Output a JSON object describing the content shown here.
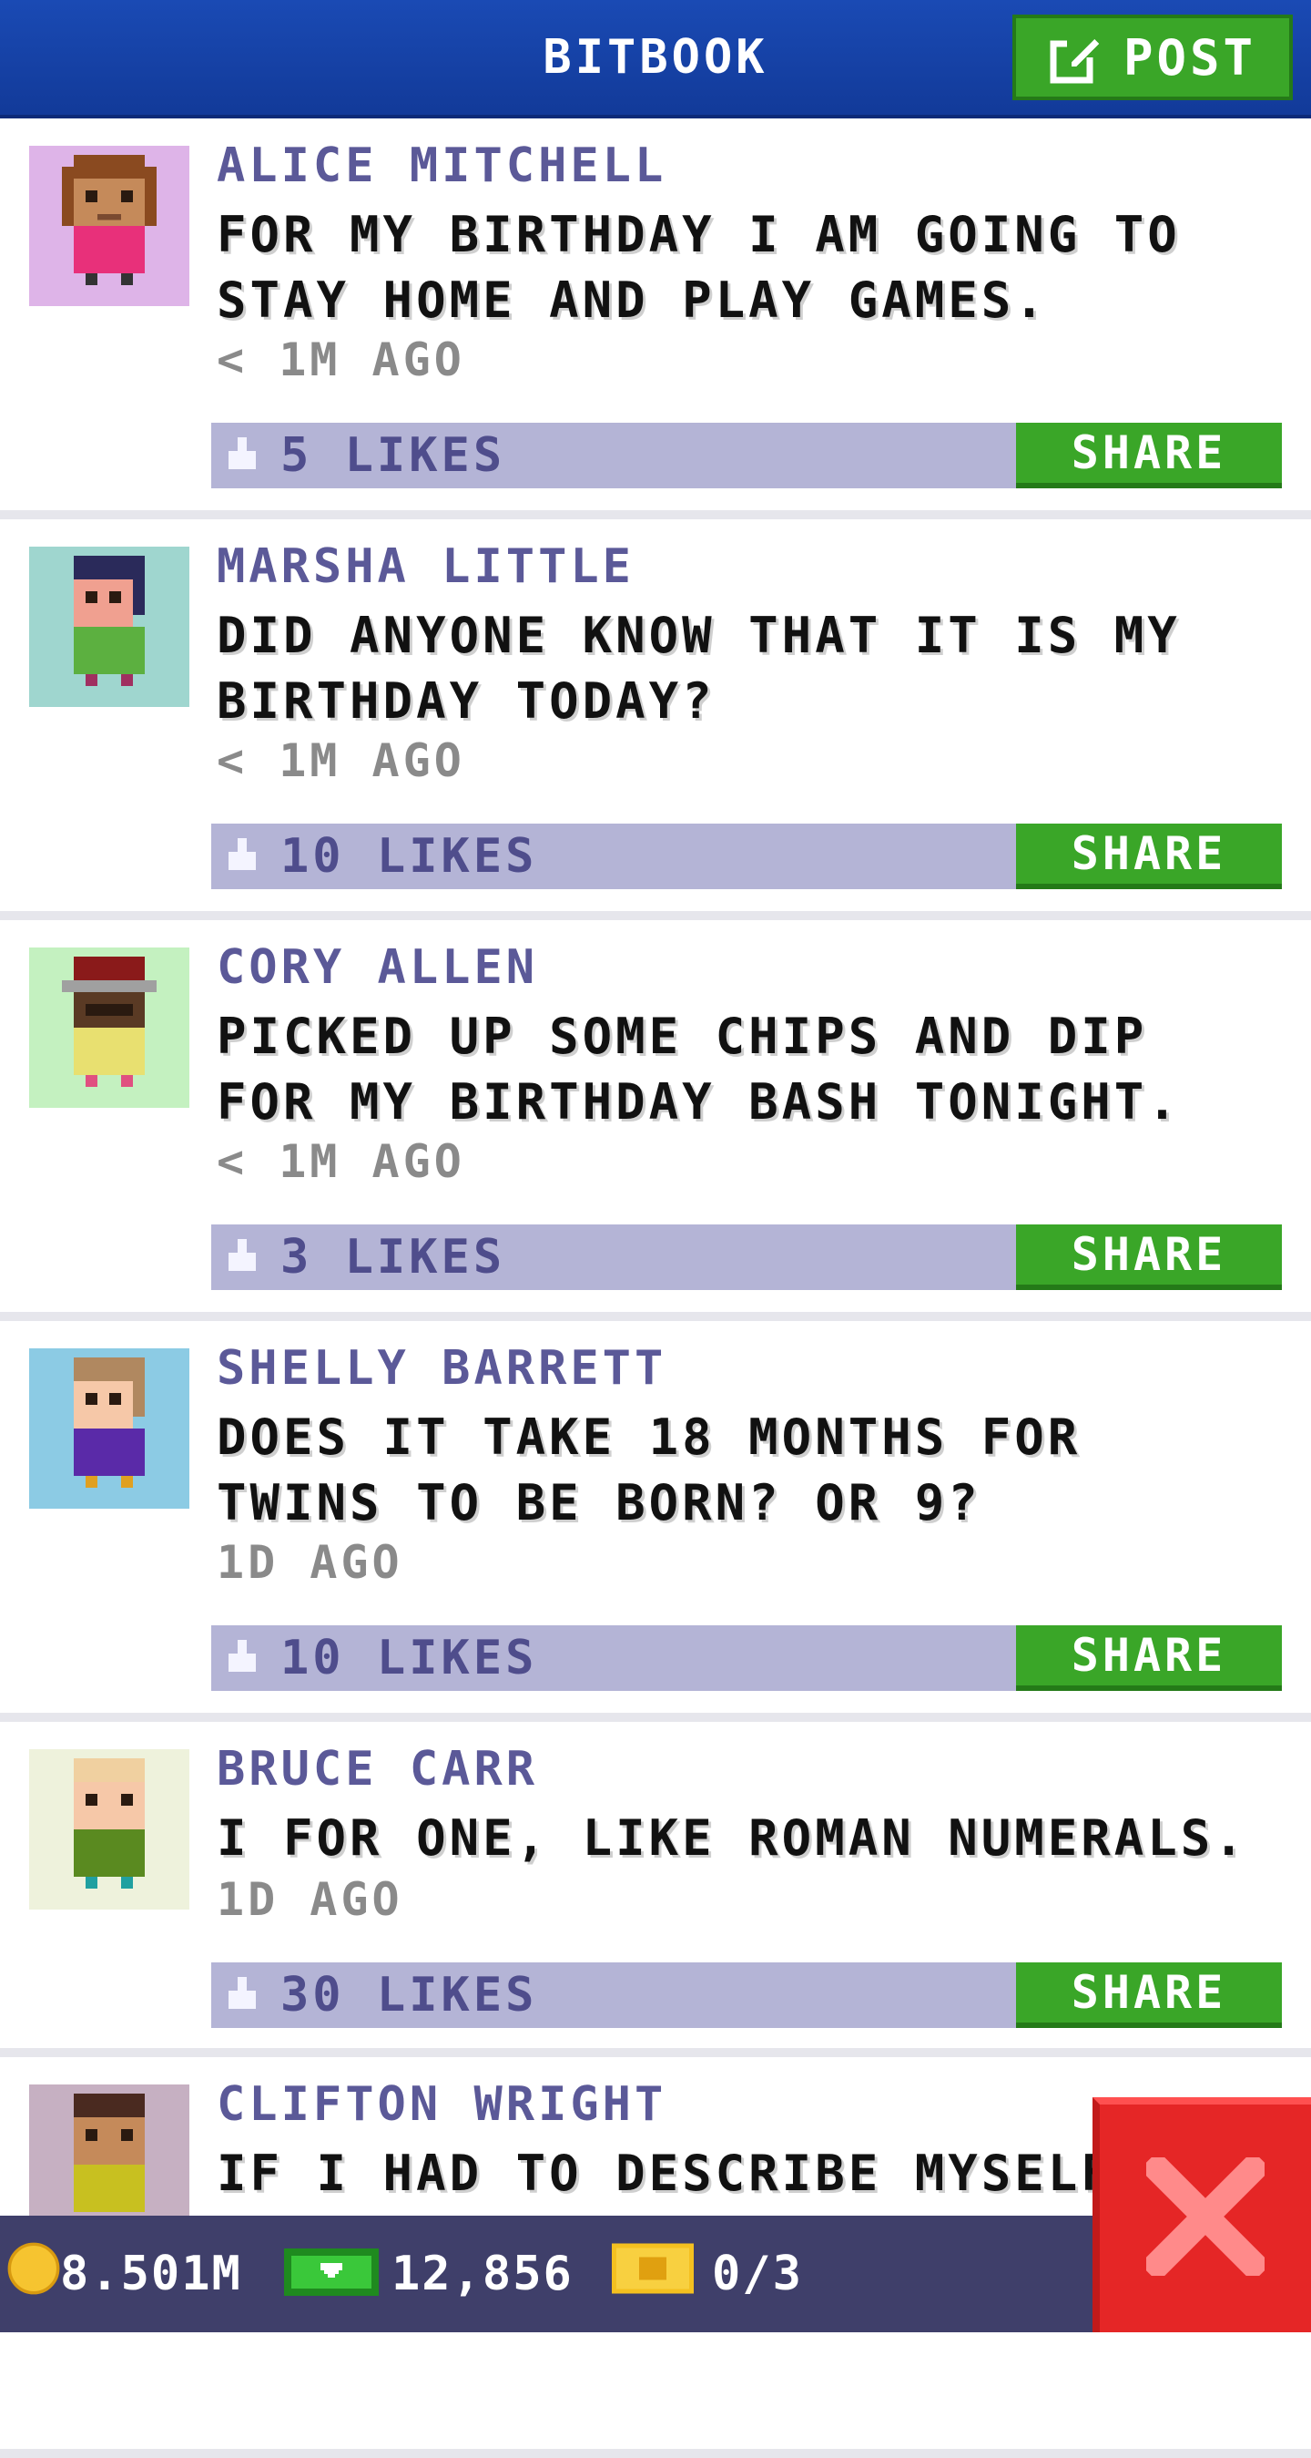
{
  "header": {
    "title": "BITBOOK",
    "post_label": "POST"
  },
  "posts": [
    {
      "author": "ALICE MITCHELL",
      "text": "FOR MY BIRTHDAY I AM GOING TO STAY HOME AND PLAY GAMES.",
      "time": "< 1M AGO",
      "likes": "5 LIKES",
      "share": "SHARE",
      "avatar_bg": "#deb4e8"
    },
    {
      "author": "MARSHA LITTLE",
      "text": "DID ANYONE KNOW THAT IT IS MY BIRTHDAY TODAY?",
      "time": "< 1M AGO",
      "likes": "10 LIKES",
      "share": "SHARE",
      "avatar_bg": "#9fd6cf"
    },
    {
      "author": "CORY ALLEN",
      "text": "PICKED UP SOME CHIPS AND DIP FOR MY BIRTHDAY BASH TONIGHT.",
      "time": "< 1M AGO",
      "likes": "3 LIKES",
      "share": "SHARE",
      "avatar_bg": "#c4f1c0"
    },
    {
      "author": "SHELLY BARRETT",
      "text": "DOES IT TAKE 18 MONTHS FOR TWINS TO BE BORN? OR 9?",
      "time": "1D AGO",
      "likes": "10 LIKES",
      "share": "SHARE",
      "avatar_bg": "#8ccbe4"
    },
    {
      "author": "BRUCE CARR",
      "text": "I FOR ONE, LIKE ROMAN NUMERALS.",
      "time": "1D AGO",
      "likes": "30 LIKES",
      "share": "SHARE",
      "avatar_bg": "#eef2dc"
    },
    {
      "author": "CLIFTON WRIGHT",
      "text": "IF I HAD TO DESCRIBE MYSELF IN",
      "time": "",
      "likes": "",
      "share": "",
      "avatar_bg": "#c6b0c2"
    }
  ],
  "status": {
    "coins": "8.501M",
    "bux": "12,856",
    "tickets": "0/3"
  },
  "colors": {
    "header": "#1a4ab4",
    "green": "#3aa628",
    "likebar": "#b4b4d6",
    "close": "#e52626"
  },
  "icons": {
    "post": "edit-icon",
    "like": "thumbs-up-icon",
    "coins": "coin-icon",
    "bux": "bux-icon",
    "tickets": "ticket-icon",
    "close": "close-icon"
  }
}
